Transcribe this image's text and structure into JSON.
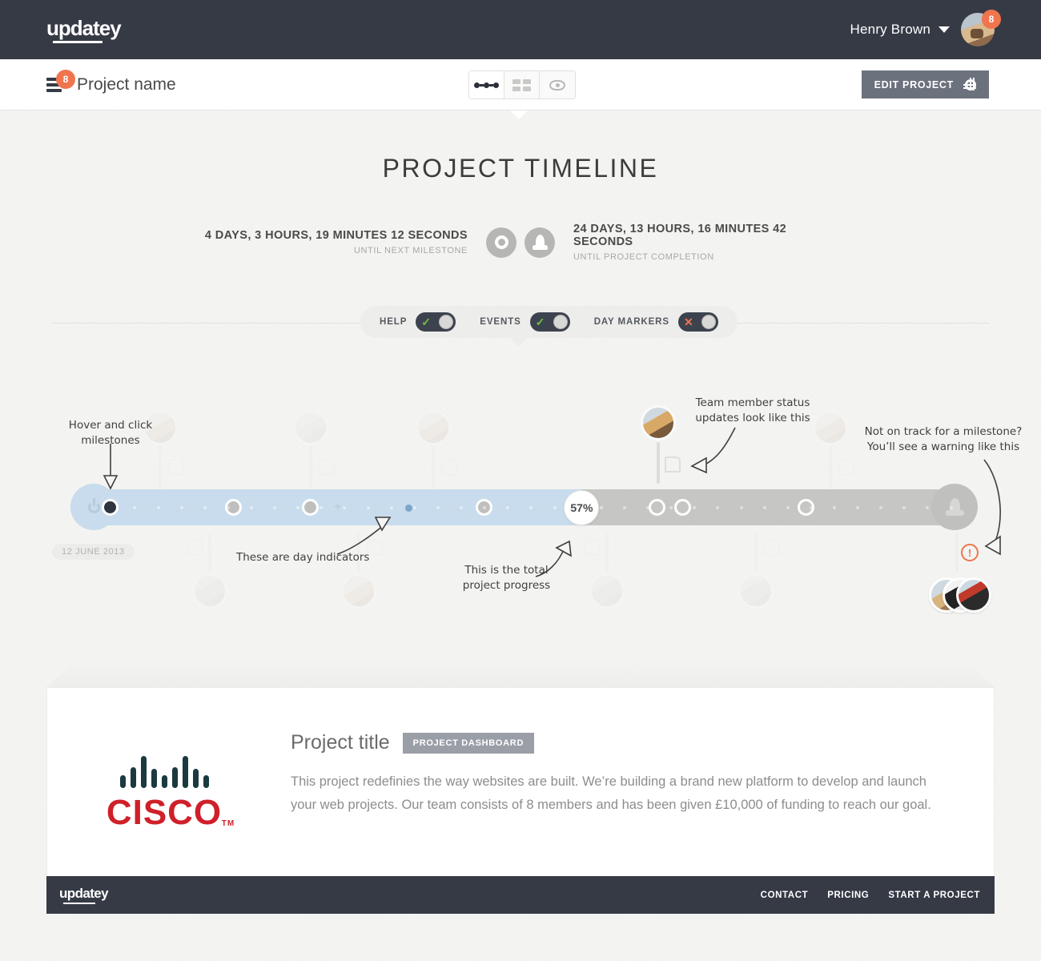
{
  "topbar": {
    "logo": "updatey",
    "user_name": "Henry Brown",
    "notification_count": "8",
    "chevron_icon": "chevron-down-icon",
    "avatar_icon": "user-avatar"
  },
  "subheader": {
    "project_name": "Project name",
    "project_badge_count": "8",
    "menu_icon": "hamburger-icon",
    "view_toggles": [
      {
        "name": "timeline-view",
        "icon": "dots-connected-icon",
        "active": true
      },
      {
        "name": "grid-view",
        "icon": "grid-icon",
        "active": false
      },
      {
        "name": "preview-view",
        "icon": "eye-icon",
        "active": false
      }
    ],
    "edit_button": "EDIT PROJECT",
    "edit_icon": "gear-icon"
  },
  "hero": {
    "title": "PROJECT TIMELINE",
    "counters": [
      {
        "value": "4 DAYS, 3 HOURS, 19 MINUTES 12 SECONDS",
        "label": "UNTIL NEXT MILESTONE",
        "icon": "milestone-ring-icon"
      },
      {
        "value": "24 DAYS, 13 HOURS, 16 MINUTES 42 SECONDS",
        "label": "UNTIL PROJECT COMPLETION",
        "icon": "rocket-icon"
      }
    ]
  },
  "toggles": [
    {
      "label": "HELP",
      "state": "on",
      "mark": "✓"
    },
    {
      "label": "EVENTS",
      "state": "on",
      "mark": "✓"
    },
    {
      "label": "DAY MARKERS",
      "state": "off",
      "mark": "✕"
    }
  ],
  "timeline": {
    "progress_percent": "57%",
    "progress_value": 57,
    "start_date": "12 JUNE 2013",
    "start_icon": "power-icon",
    "end_icon": "rocket-icon",
    "warning_icon": "warning-exclamation-icon",
    "milestones": [
      {
        "pos": 4.4,
        "state": "done-dark"
      },
      {
        "pos": 18.1,
        "state": "done-grey"
      },
      {
        "pos": 26.7,
        "state": "done-grey"
      },
      {
        "pos": 46.1,
        "state": "done-grey"
      },
      {
        "pos": 65.4,
        "state": "todo"
      },
      {
        "pos": 68.2,
        "state": "todo"
      },
      {
        "pos": 82.0,
        "state": "todo"
      }
    ],
    "day_indicator_pos": 37.7,
    "plus_marker_pos": 29.8
  },
  "annotations": [
    {
      "name": "hover-click-annotation",
      "text": "Hover and click\nmilestones"
    },
    {
      "name": "day-indicator-annotation",
      "text": "These are day indicators"
    },
    {
      "name": "progress-annotation",
      "text": "This is the total\nproject progress"
    },
    {
      "name": "status-update-annotation",
      "text": "Team member status\nupdates look like this"
    },
    {
      "name": "warning-annotation",
      "text": "Not on track for a milestone?\nYou’ll see a warning like this"
    }
  ],
  "card": {
    "brand": "CISCO",
    "brand_tm": "TM",
    "title": "Project title",
    "dashboard_badge": "PROJECT DASHBOARD",
    "description": "This project redefinies the way websites are built. We’re building a brand new platform to develop and launch your web projects. Our team consists of 8 members and has been given £10,000 of funding to reach our goal."
  },
  "footer": {
    "logo": "updatey",
    "links": [
      "CONTACT",
      "PRICING",
      "START A PROJECT"
    ]
  },
  "colors": {
    "dark": "#353a45",
    "accent_orange": "#f0744d",
    "progress_blue": "#c8dced",
    "track_grey": "#c6c6c4",
    "toggle_green": "#6fc04a",
    "cisco_red": "#cf2029",
    "cisco_teal": "#1b3a40"
  }
}
